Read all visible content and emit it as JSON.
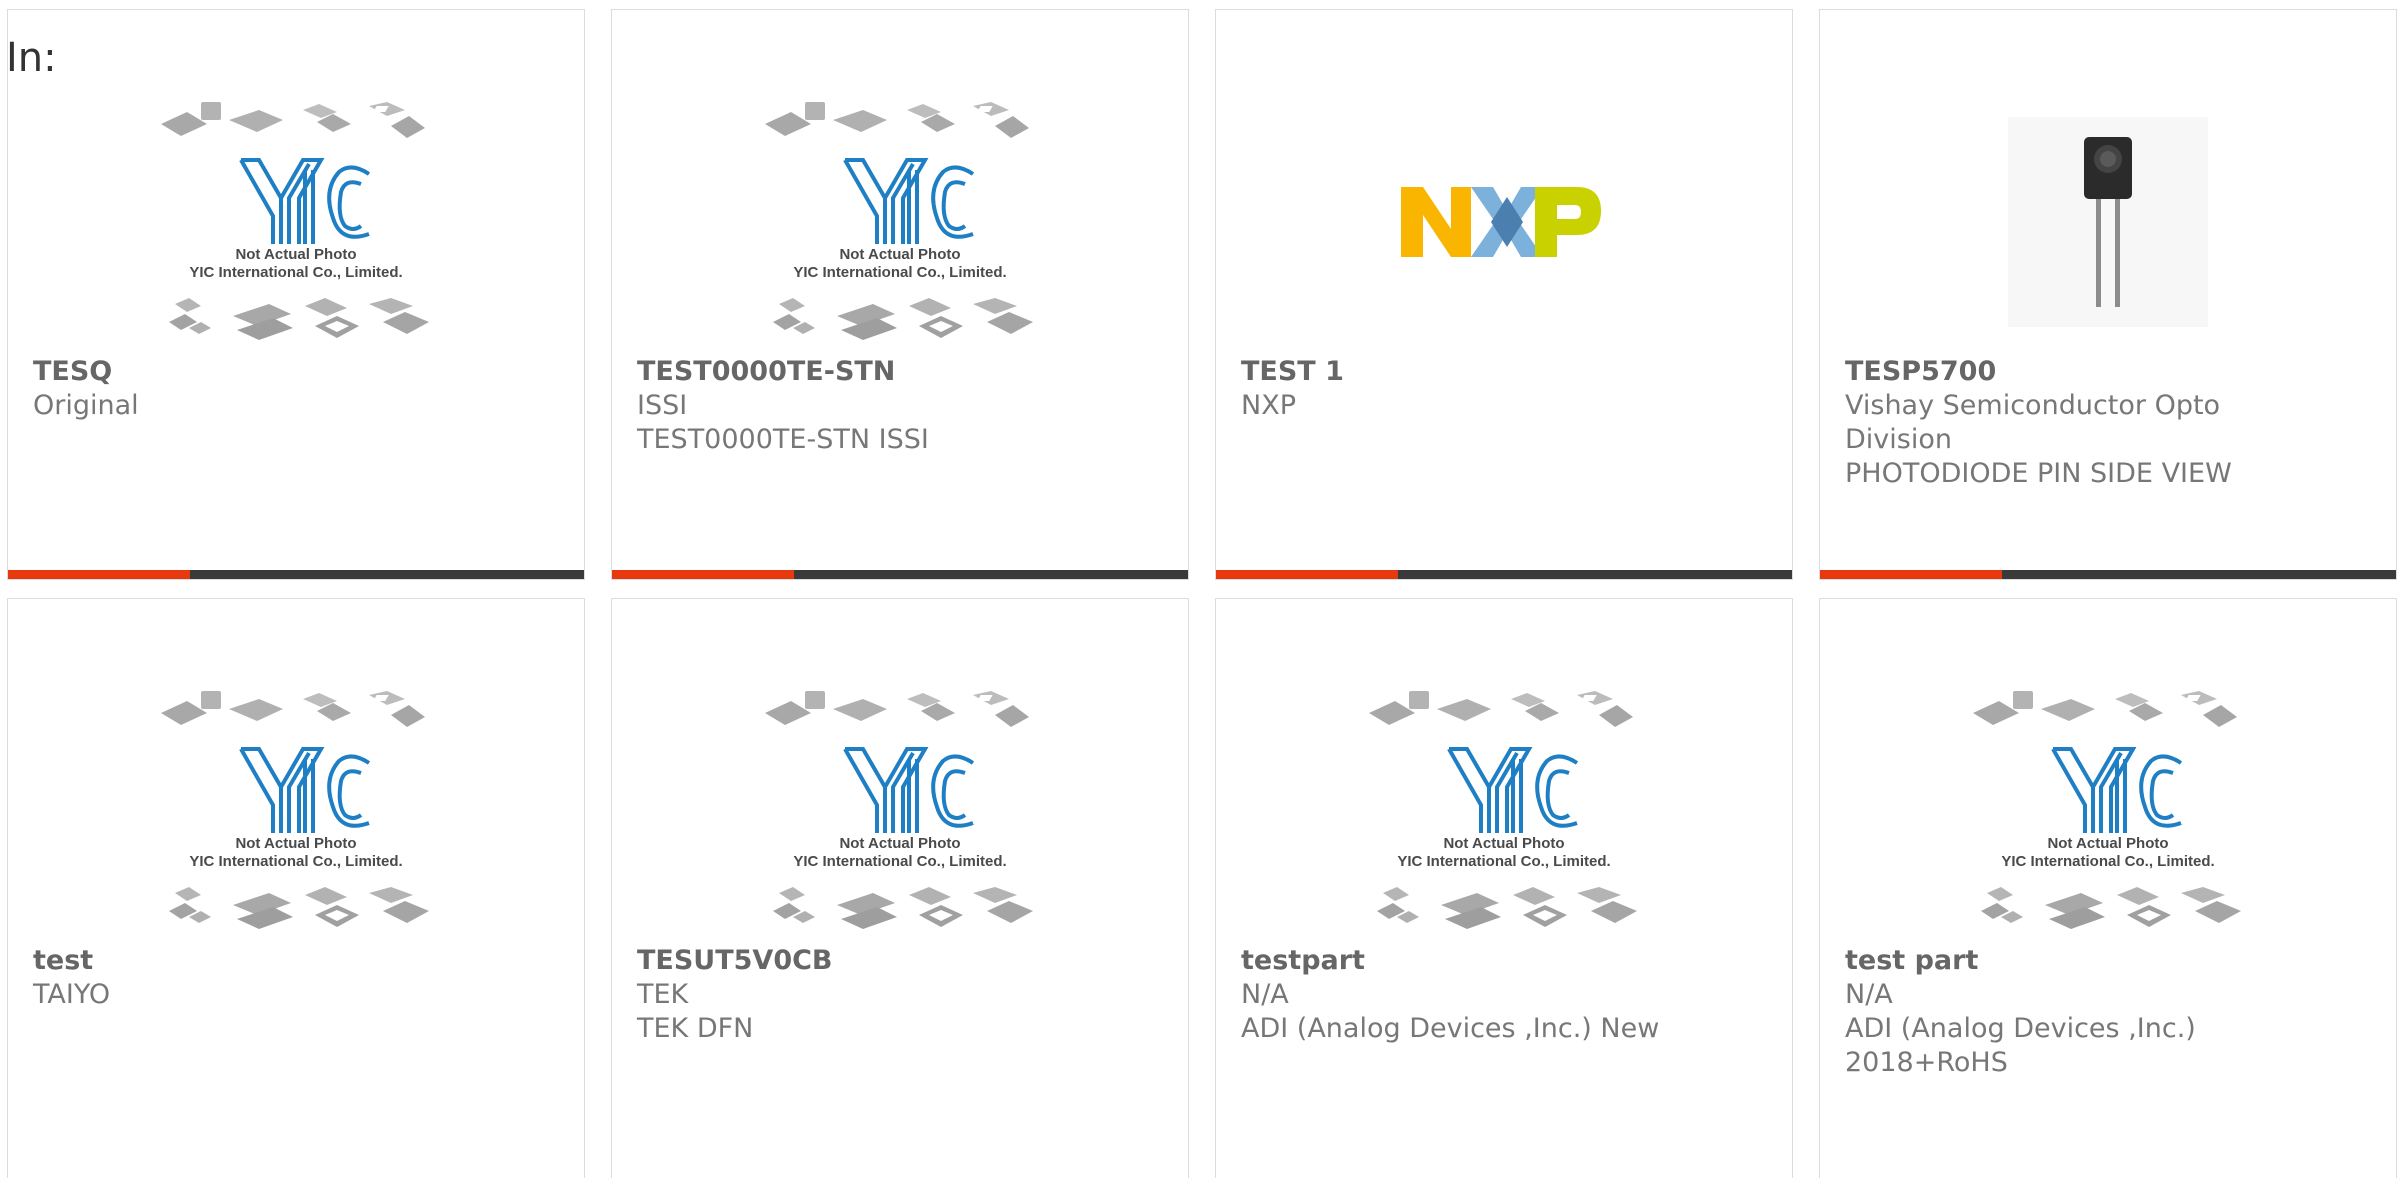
{
  "filter_label": "In:",
  "placeholder": {
    "brand": "YIC",
    "line1": "Not Actual Photo",
    "line2": "YIC International Co., Limited."
  },
  "nxp_logo": "NXP",
  "products": [
    {
      "part": "TESQ",
      "lines": [
        "Original"
      ],
      "image": "placeholder"
    },
    {
      "part": "TEST0000TE-STN",
      "lines": [
        "ISSI",
        "TEST0000TE-STN ISSI"
      ],
      "image": "placeholder"
    },
    {
      "part": "TEST 1",
      "lines": [
        "NXP"
      ],
      "image": "nxp-logo"
    },
    {
      "part": "TESP5700",
      "lines": [
        "Vishay Semiconductor Opto",
        "Division",
        "PHOTODIODE PIN SIDE VIEW"
      ],
      "image": "photodiode-photo"
    },
    {
      "part": "test",
      "lines": [
        "TAIYO"
      ],
      "image": "placeholder"
    },
    {
      "part": "TESUT5V0CB",
      "lines": [
        "TEK",
        "TEK DFN"
      ],
      "image": "placeholder"
    },
    {
      "part": "testpart",
      "lines": [
        "N/A",
        "ADI (Analog Devices ,Inc.) New"
      ],
      "image": "placeholder"
    },
    {
      "part": "test part",
      "lines": [
        "N/A",
        "ADI (Analog Devices ,Inc.)",
        "2018+RoHS"
      ],
      "image": "placeholder"
    }
  ],
  "colors": {
    "accent": "#e8380d",
    "bar": "#3a3a3a",
    "brand_blue": "#1f7fc4",
    "nxp_orange": "#f9b500",
    "nxp_blue": "#7bb1db",
    "nxp_green": "#c9d200"
  }
}
